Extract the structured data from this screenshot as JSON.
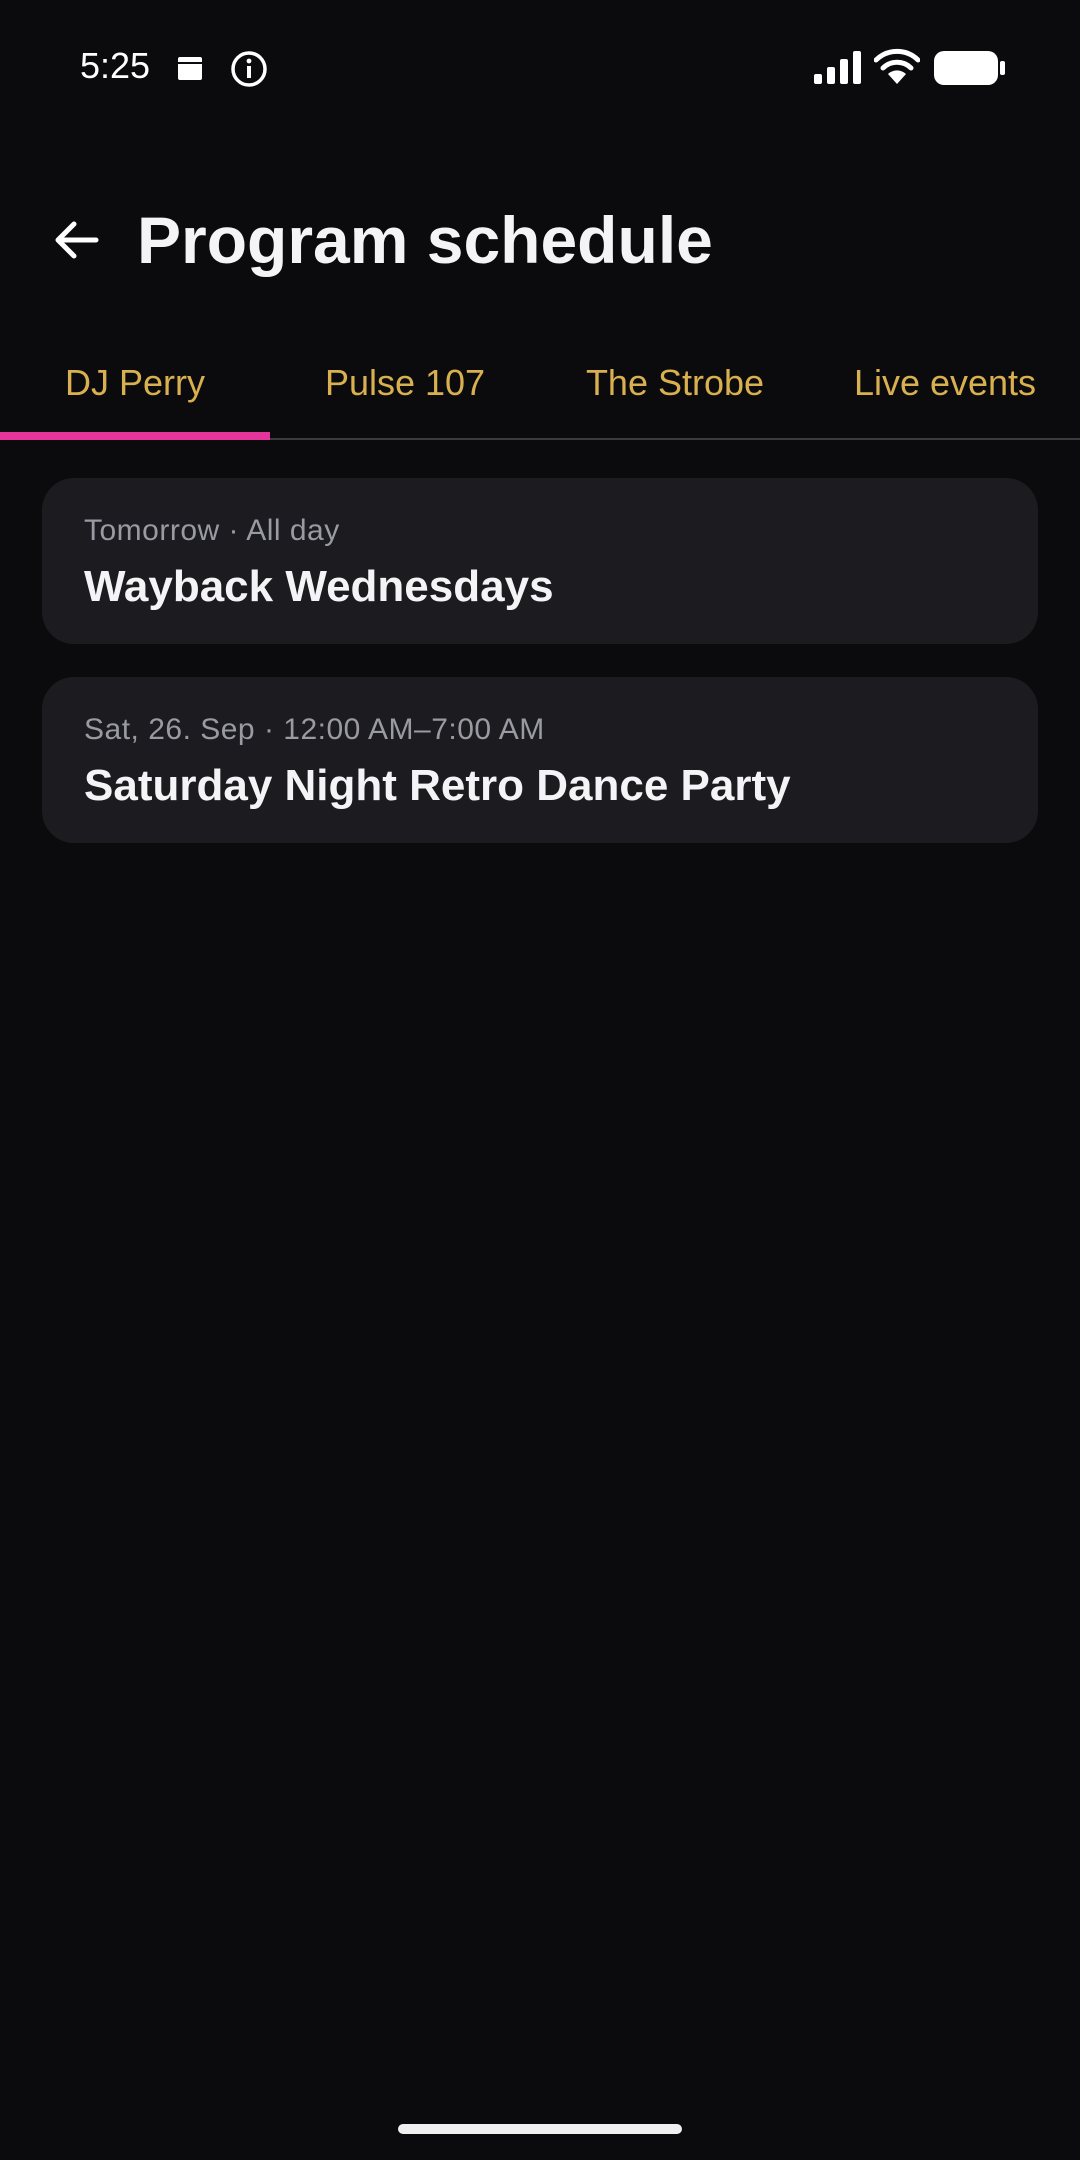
{
  "status_bar": {
    "time": "5:25",
    "left_icons": [
      "calendar-icon",
      "info-icon"
    ],
    "right_icons": [
      "signal-icon",
      "wifi-icon",
      "battery-icon"
    ]
  },
  "header": {
    "back_icon": "arrow-left-icon",
    "title": "Program schedule"
  },
  "tabs": [
    {
      "label": "DJ Perry",
      "selected": true
    },
    {
      "label": "Pulse 107",
      "selected": false
    },
    {
      "label": "The Strobe",
      "selected": false
    },
    {
      "label": "Live events",
      "selected": false
    }
  ],
  "events": [
    {
      "meta": "Tomorrow · All day",
      "title": "Wayback Wednesdays"
    },
    {
      "meta": "Sat, 26. Sep · 12:00 AM–7:00 AM",
      "title": "Saturday Night Retro Dance Party"
    }
  ],
  "colors": {
    "background": "#0b0b0d",
    "card": "#1b1b20",
    "tab_text": "#d9b04f",
    "tab_indicator": "#e5359a",
    "meta_text": "#9a9aa2",
    "title_text": "#f4f4f6"
  }
}
